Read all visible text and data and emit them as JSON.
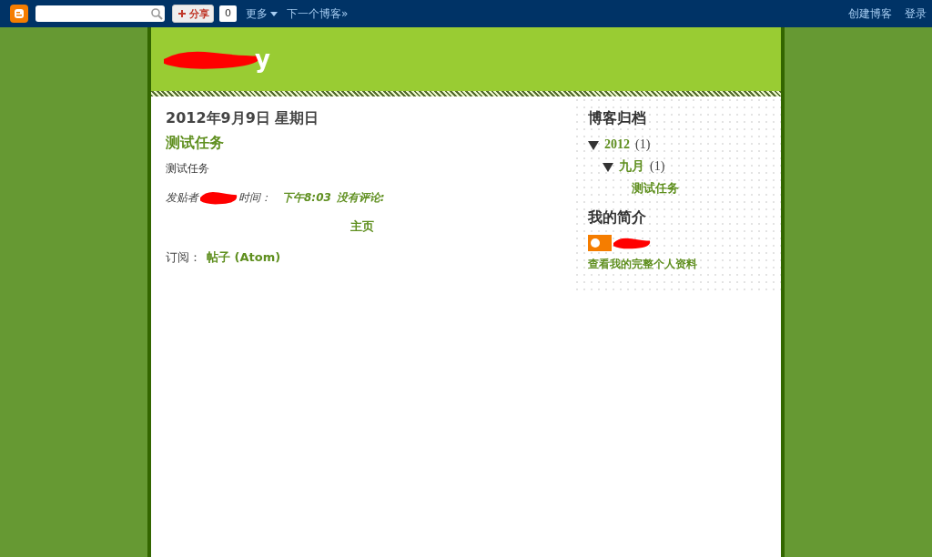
{
  "navbar": {
    "share_button": "分享",
    "share_count": "0",
    "more_menu": "更多",
    "next_blog": "下一个博客»",
    "create_blog": "创建博客",
    "login": "登录"
  },
  "header": {
    "title": "y"
  },
  "post": {
    "date": "2012年9月9日 星期日",
    "title": "测试任务",
    "body": "测试任务",
    "posted_by": "发贴者",
    "time_label": "时间：",
    "time": "下午8:03",
    "comments": "没有评论:"
  },
  "home_link": "主页",
  "subscribe": {
    "label": "订阅：",
    "link": "帖子 (Atom)"
  },
  "sidebar": {
    "archive_title": "博客归档",
    "archive": [
      {
        "label": "2012",
        "count": "(1)",
        "expanded": true,
        "children": [
          {
            "label": "九月",
            "count": "(1)",
            "expanded": true,
            "children": [
              {
                "label": "测试任务"
              }
            ]
          }
        ]
      }
    ],
    "profile_title": "我的简介",
    "profile_link": "查看我的完整个人资料"
  }
}
